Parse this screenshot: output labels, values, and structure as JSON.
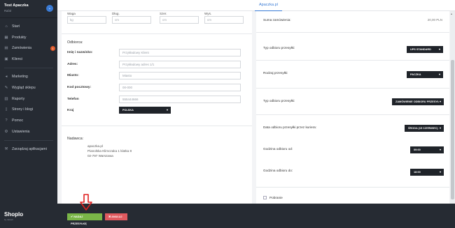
{
  "sidebar": {
    "store_name": "Test Apaczka",
    "store_user": "Rafał",
    "items": [
      {
        "label": "Start",
        "icon": "home-icon"
      },
      {
        "label": "Produkty",
        "icon": "tag-icon"
      },
      {
        "label": "Zamówienia",
        "icon": "cart-icon",
        "badge": "1"
      },
      {
        "label": "Klienci",
        "icon": "users-icon"
      },
      {
        "label": "Marketing",
        "icon": "megaphone-icon"
      },
      {
        "label": "Wygląd sklepu",
        "icon": "brush-icon"
      },
      {
        "label": "Raporty",
        "icon": "chart-icon"
      },
      {
        "label": "Strony i blogi",
        "icon": "page-icon"
      },
      {
        "label": "Pomoc",
        "icon": "help-icon"
      },
      {
        "label": "Ustawienia",
        "icon": "gear-icon"
      },
      {
        "label": "Zarządzaj aplikacjami",
        "icon": "apps-icon"
      }
    ],
    "logo": "Shoplo",
    "logo_sub": "by Idosell"
  },
  "topbar": {
    "tab": "Apaczka.pl"
  },
  "dimensions": {
    "labels": [
      "Waga",
      "Dług.",
      "Szer.",
      "Wys."
    ],
    "units": [
      "kg",
      "cm",
      "cm",
      "cm"
    ]
  },
  "recipient": {
    "title": "Odbiorca:",
    "fields": [
      {
        "label": "Imię i nazwisko:",
        "value": "Przykładowy Klient"
      },
      {
        "label": "Adres:",
        "value": "Przykładowy adres 1/1"
      },
      {
        "label": "Miasto:",
        "value": "Miasto"
      },
      {
        "label": "Kod pocztowy:",
        "value": "00-000"
      },
      {
        "label": "Telefon",
        "value": "555444666"
      }
    ],
    "country_label": "Kraj",
    "country_value": "POLSKA"
  },
  "sender": {
    "title": "Nadawca:",
    "lines": [
      "apaczka.pl",
      "Pianolska Klimczaka 1 klatka 8",
      "02-797 Warszawa"
    ]
  },
  "right": {
    "order_sum_label": "Suma zamówienia:",
    "order_sum_value": "20,00 PLN",
    "service_label": "Typ odbioru przesyłki:",
    "service_value": "UPS STANDARD",
    "parcel_label": "Rodzaj przesyłki:",
    "parcel_value": "PACZKA",
    "pickup_type_label": "Typ odbioru przesyłki:",
    "pickup_type_value": "ZAMÓWIENIE ODBIORU PRZESYŁ",
    "pickup_date_label": "Data odbioru przesyłki przez kuriera:",
    "pickup_date_value": "ŚRODA (15 CZERWIEC)",
    "pickup_from_label": "Godzina odbioru od:",
    "pickup_from_value": "09:00",
    "pickup_to_label": "Godzina odbioru do:",
    "pickup_to_value": "18:00",
    "cod_label": "Pobranie"
  },
  "footer": {
    "send_label": "✔ NADAJ PRZESYŁKĘ",
    "cancel_label": "✖ ANULUJ"
  }
}
